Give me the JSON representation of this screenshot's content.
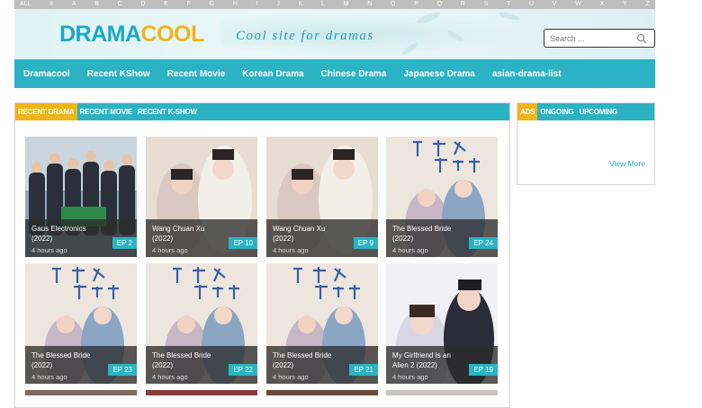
{
  "alphabet": [
    "ALL",
    "#",
    "A",
    "B",
    "C",
    "D",
    "E",
    "F",
    "G",
    "H",
    "I",
    "J",
    "K",
    "L",
    "M",
    "N",
    "O",
    "P",
    "Q",
    "R",
    "S",
    "T",
    "U",
    "V",
    "W",
    "X",
    "Y",
    "Z"
  ],
  "header": {
    "logo_part1": "DRAMA",
    "logo_part2": "COOL",
    "tagline": "Cool site for dramas",
    "search_placeholder": "Search ..."
  },
  "nav": [
    "Dramacool",
    "Recent KShow",
    "Recent Movie",
    "Korean Drama",
    "Chinese Drama",
    "Japanese Drama",
    "asian-drama-list"
  ],
  "main_tabs": [
    "Recent Drama",
    "Recent Movie",
    "Recent K-Show"
  ],
  "side_tabs": [
    "Ads",
    "Ongoing",
    "Upcoming"
  ],
  "side_view_more": "View More",
  "colors": {
    "accent": "#2bb3c4",
    "highlight": "#f0b417",
    "logo_blue": "#1aa8c8"
  },
  "cards": [
    {
      "title": "Gaus Electronics (2022)",
      "ep": "EP 2",
      "time": "4 hours ago",
      "art": "office-group-poster"
    },
    {
      "title": "Wang Chuan Xu (2022)",
      "ep": "EP 10",
      "time": "4 hours ago",
      "art": "hanfu-couple-poster"
    },
    {
      "title": "Wang Chuan Xu (2022)",
      "ep": "EP 9",
      "time": "4 hours ago",
      "art": "hanfu-couple-poster"
    },
    {
      "title": "The Blessed Bride (2022)",
      "ep": "EP 24",
      "time": "4 hours ago",
      "art": "calligraphy-couple-poster"
    },
    {
      "title": "The Blessed Bride (2022)",
      "ep": "EP 23",
      "time": "4 hours ago",
      "art": "calligraphy-couple-poster"
    },
    {
      "title": "The Blessed Bride (2022)",
      "ep": "EP 22",
      "time": "4 hours ago",
      "art": "calligraphy-couple-poster"
    },
    {
      "title": "The Blessed Bride (2022)",
      "ep": "EP 21",
      "time": "4 hours ago",
      "art": "calligraphy-couple-poster"
    },
    {
      "title": "My Girlfriend Is an Alien 2 (2022)",
      "ep": "EP 19",
      "time": "4 hours ago",
      "art": "modern-couple-poster"
    }
  ],
  "cards_partial_row": [
    "poster-thumbnail",
    "poster-thumbnail",
    "poster-thumbnail",
    "poster-thumbnail"
  ]
}
